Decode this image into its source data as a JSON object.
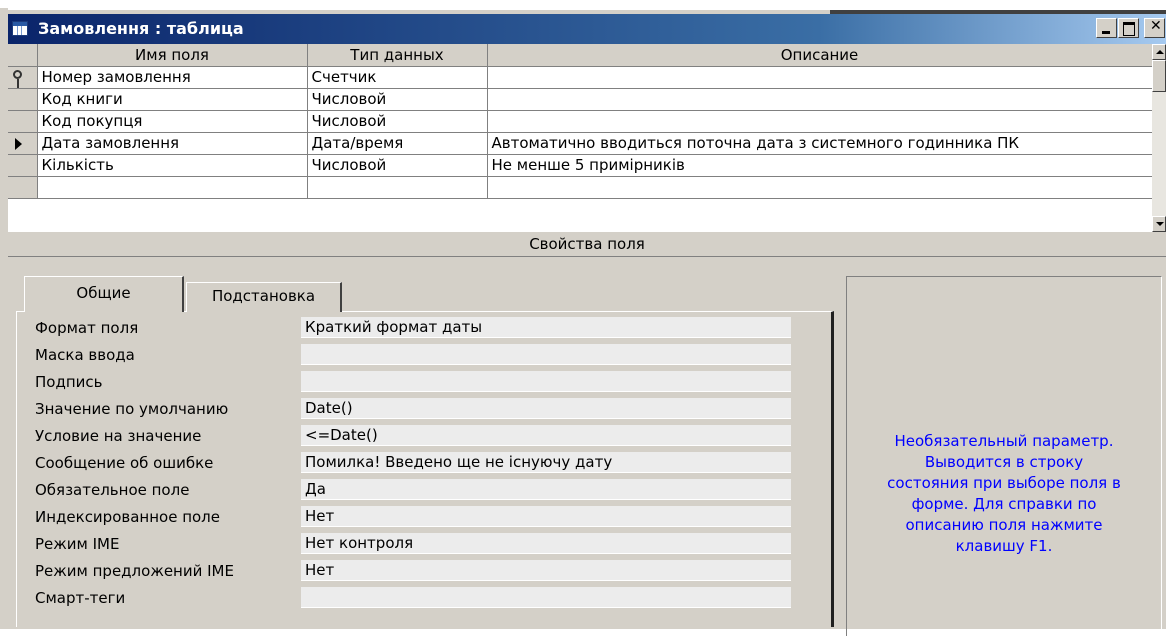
{
  "window": {
    "title": "Замовлення : таблица",
    "icon": "table-icon"
  },
  "grid": {
    "columns": [
      "Имя поля",
      "Тип данных",
      "Описание"
    ],
    "rows": [
      {
        "name": "Номер замовлення",
        "type": "Счетчик",
        "description": "",
        "marker": "key-icon"
      },
      {
        "name": "Код книги",
        "type": "Числовой",
        "description": "",
        "marker": ""
      },
      {
        "name": "Код покупця",
        "type": "Числовой",
        "description": "",
        "marker": ""
      },
      {
        "name": "Дата замовлення",
        "type": "Дата/время",
        "description": "Автоматично вводиться поточна дата з системного годинника ПК",
        "marker": "current-row-arrow-icon"
      },
      {
        "name": "Кількість",
        "type": "Числовой",
        "description": "Не менше 5 примірників",
        "marker": ""
      },
      {
        "name": "",
        "type": "",
        "description": "",
        "marker": ""
      }
    ]
  },
  "properties": {
    "header": "Свойства поля",
    "tabs": [
      {
        "label": "Общие",
        "active": true
      },
      {
        "label": "Подстановка",
        "active": false
      }
    ],
    "items": [
      {
        "label": "Формат поля",
        "value": "Краткий формат даты"
      },
      {
        "label": "Маска ввода",
        "value": ""
      },
      {
        "label": "Подпись",
        "value": ""
      },
      {
        "label": "Значение по умолчанию",
        "value": "Date()"
      },
      {
        "label": "Условие на значение",
        "value": "<=Date()"
      },
      {
        "label": "Сообщение об ошибке",
        "value": "Помилка! Введено ще не існуючу дату"
      },
      {
        "label": "Обязательное поле",
        "value": "Да"
      },
      {
        "label": "Индексированное поле",
        "value": "Нет"
      },
      {
        "label": "Режим IME",
        "value": "Нет контроля"
      },
      {
        "label": "Режим предложений IME",
        "value": "Нет"
      },
      {
        "label": "Смарт-теги",
        "value": ""
      }
    ]
  },
  "help": {
    "text": "Необязательный параметр.\nВыводится в строку\nсостояния при выборе поля в\nформе.  Для справки по\nописанию поля нажмите\nклавишу F1."
  },
  "colors": {
    "title_start": "#0a246a",
    "title_end": "#a6caf0",
    "help_text": "#0000ff",
    "chrome": "#d4d0c8"
  }
}
